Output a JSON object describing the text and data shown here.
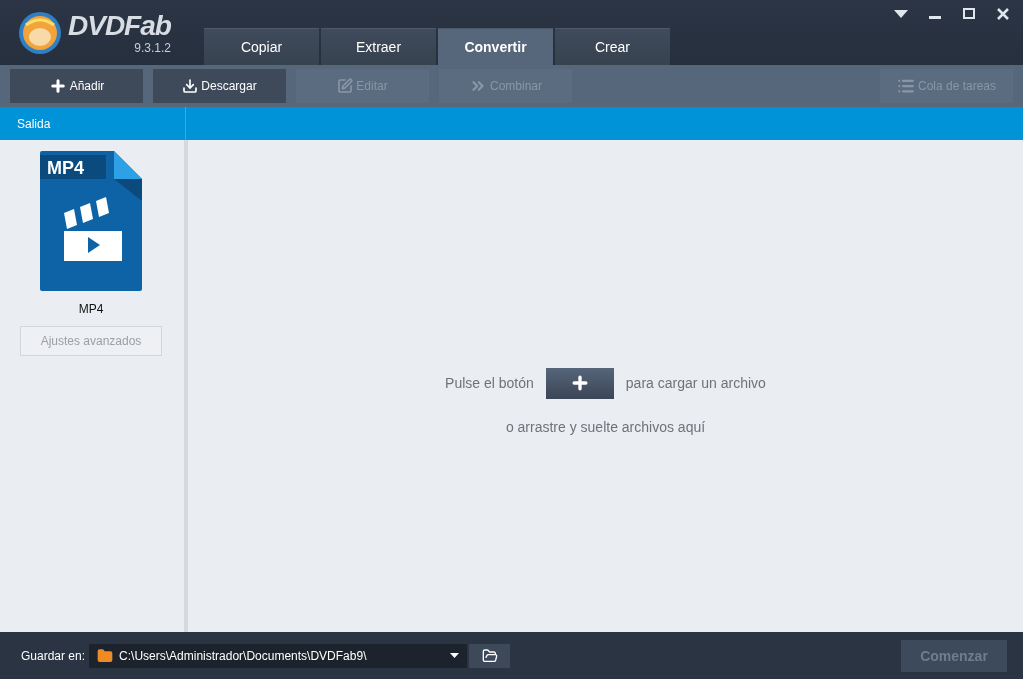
{
  "app": {
    "logo_text": "DVDFab",
    "version": "9.3.1.2"
  },
  "tabs": [
    {
      "label": "Copiar",
      "selected": false
    },
    {
      "label": "Extraer",
      "selected": false
    },
    {
      "label": "Convertir",
      "selected": true
    },
    {
      "label": "Crear",
      "selected": false
    }
  ],
  "toolbar": [
    {
      "kind": "add",
      "label": "Añadir",
      "disabled": false
    },
    {
      "kind": "download",
      "label": "Descargar",
      "disabled": false
    },
    {
      "kind": "edit",
      "label": "Editar",
      "disabled": true
    },
    {
      "kind": "merge",
      "label": "Combinar",
      "disabled": true
    }
  ],
  "queue_button": {
    "label": "Cola de tareas",
    "disabled": true
  },
  "sidebar": {
    "header": "Salida",
    "profile_badge": "MP4",
    "profile_name": "MP4",
    "advanced_button": {
      "label": "Ajustes avanzados",
      "disabled": true
    }
  },
  "main": {
    "hint_before": "Pulse el botón",
    "hint_after": "para cargar un archivo",
    "hint_line2": "o arrastre y suelte archivos aquí"
  },
  "footer": {
    "save_label": "Guardar en:",
    "path": "C:\\Users\\Administrador\\Documents\\DVDFab9\\",
    "start_button": {
      "label": "Comenzar",
      "disabled": true
    }
  }
}
